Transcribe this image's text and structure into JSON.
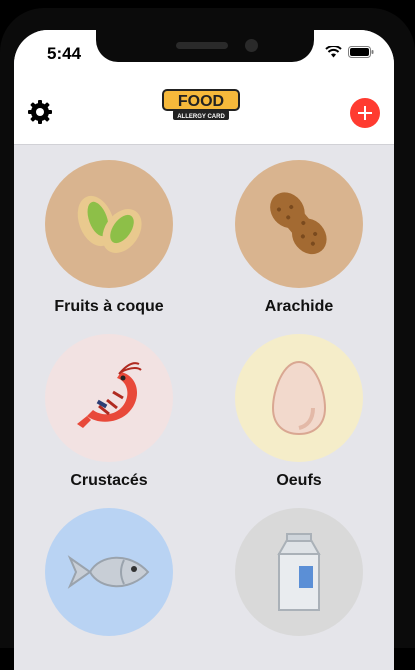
{
  "status": {
    "time": "5:44"
  },
  "header": {
    "logo_alt": "Food Allergy Card"
  },
  "allergens": [
    {
      "label": "Fruits à coque",
      "icon": "pistachio-icon",
      "bg": "#d9b48f"
    },
    {
      "label": "Arachide",
      "icon": "peanut-icon",
      "bg": "#d9b48f"
    },
    {
      "label": "Crustacés",
      "icon": "shrimp-icon",
      "bg": "#f2e2e2"
    },
    {
      "label": "Oeufs",
      "icon": "egg-icon",
      "bg": "#f5edc9"
    },
    {
      "label": "",
      "icon": "fish-icon",
      "bg": "#b9d3f3"
    },
    {
      "label": "",
      "icon": "milk-carton-icon",
      "bg": "#d9d9d9"
    }
  ],
  "colors": {
    "accent": "#ff3b30",
    "background": "#e5e5ea"
  }
}
